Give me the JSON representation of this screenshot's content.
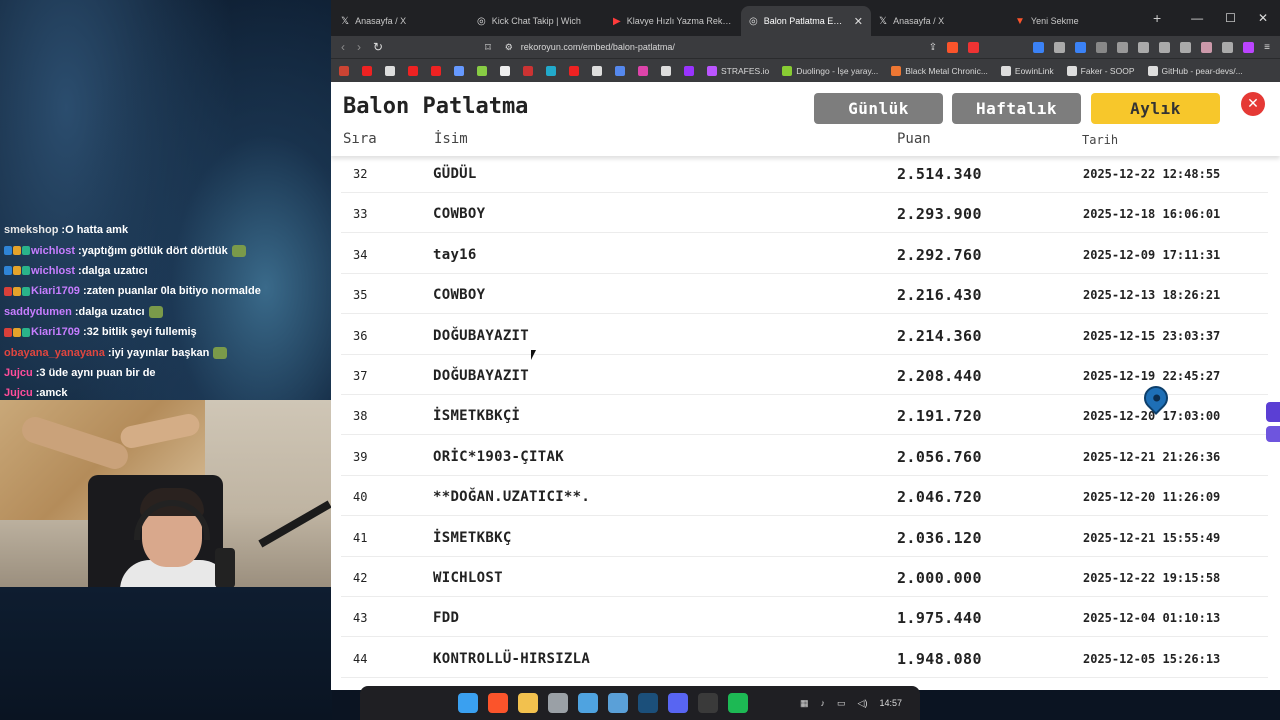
{
  "chat": [
    {
      "user": "smekshop",
      "msg": "O hatta amk",
      "user_color": "#e8e8e8",
      "badges": 0
    },
    {
      "user": "wichlost",
      "msg": "yaptığım götlük dört dörtlük",
      "user_color": "#c77dff",
      "badges": 3,
      "emote": true
    },
    {
      "user": "wichlost",
      "msg": "dalga uzatıcı",
      "user_color": "#c77dff",
      "badges": 3
    },
    {
      "user": "Kiari1709",
      "msg": "zaten puanlar 0la bitiyo normalde",
      "user_color": "#c77dff",
      "badges": 3
    },
    {
      "user": "saddydumen",
      "msg": "dalga uzatıcı",
      "user_color": "#c77dff",
      "badges": 0,
      "emote": true
    },
    {
      "user": "Kiari1709",
      "msg": "32 bitlik şeyi fullemiş",
      "user_color": "#c77dff",
      "badges": 3
    },
    {
      "user": "obayana_yanayana",
      "msg": "iyi yayınlar başkan",
      "user_color": "#e0463f",
      "badges": 0,
      "emote": true
    },
    {
      "user": "Jujcu",
      "msg": "3 üde aynı puan bir de",
      "user_color": "#ff4d9a",
      "badges": 0
    },
    {
      "user": "Jujcu",
      "msg": "amck",
      "user_color": "#ff4d9a",
      "badges": 0
    }
  ],
  "browser": {
    "tabs": [
      {
        "title": "Anasayfa / X",
        "icon": "x-icon",
        "glyph": "𝕏",
        "active": false
      },
      {
        "title": "Kick Chat Takip | Wich",
        "icon": "globe-icon",
        "glyph": "◎",
        "active": false
      },
      {
        "title": "Klavye Hızlı Yazma Rekoru Kı",
        "icon": "youtube-icon",
        "glyph": "▶",
        "active": false
      },
      {
        "title": "Balon Patlatma Embed E",
        "icon": "globe-icon",
        "glyph": "◎",
        "active": true
      },
      {
        "title": "Anasayfa / X",
        "icon": "x-icon",
        "glyph": "𝕏",
        "active": false
      },
      {
        "title": "Yeni Sekme",
        "icon": "brave-icon",
        "glyph": "▼",
        "active": false
      }
    ],
    "url": "rekoroyun.com/embed/balon-patlatma/",
    "bookmarks": [
      {
        "label": "",
        "color": "#c43"
      },
      {
        "label": "",
        "color": "#e22"
      },
      {
        "label": "",
        "color": "#ddd"
      },
      {
        "label": "",
        "color": "#e22"
      },
      {
        "label": "",
        "color": "#e22"
      },
      {
        "label": "",
        "color": "#69f"
      },
      {
        "label": "",
        "color": "#8c4"
      },
      {
        "label": "",
        "color": "#eee"
      },
      {
        "label": "",
        "color": "#c33"
      },
      {
        "label": "",
        "color": "#2ac"
      },
      {
        "label": "",
        "color": "#e22"
      },
      {
        "label": "",
        "color": "#ddd"
      },
      {
        "label": "",
        "color": "#58e"
      },
      {
        "label": "",
        "color": "#d4a"
      },
      {
        "label": "",
        "color": "#ddd"
      },
      {
        "label": "",
        "color": "#93f"
      },
      {
        "label": "STRAFES.io",
        "color": "#b5f"
      },
      {
        "label": "Duolingo - İşe yaray...",
        "color": "#8c3"
      },
      {
        "label": "Black Metal Chronic...",
        "color": "#e73"
      },
      {
        "label": "EowinLink",
        "color": "#ddd"
      },
      {
        "label": "Faker - SOOP",
        "color": "#ddd"
      },
      {
        "label": "GitHub - pear-devs/...",
        "color": "#ddd"
      }
    ]
  },
  "page": {
    "title": "Balon Patlatma",
    "buttons": {
      "daily": "Günlük",
      "weekly": "Haftalık",
      "monthly": "Aylık"
    },
    "columns": {
      "rank": "Sıra",
      "name": "İsim",
      "score": "Puan",
      "date": "Tarih"
    },
    "colors": {
      "inactive_btn": "#7d7d7d",
      "active_btn": "#f7c72b",
      "close": "#e53935"
    }
  },
  "leaderboard": [
    {
      "rank": "32",
      "name": "GÜDÜL",
      "score": "2.514.340",
      "date": "2025-12-22 12:48:55"
    },
    {
      "rank": "33",
      "name": "COWBOY",
      "score": "2.293.900",
      "date": "2025-12-18 16:06:01"
    },
    {
      "rank": "34",
      "name": "tay16",
      "score": "2.292.760",
      "date": "2025-12-09 17:11:31"
    },
    {
      "rank": "35",
      "name": "COWBOY",
      "score": "2.216.430",
      "date": "2025-12-13 18:26:21"
    },
    {
      "rank": "36",
      "name": "DOĞUBAYAZIT",
      "score": "2.214.360",
      "date": "2025-12-15 23:03:37"
    },
    {
      "rank": "37",
      "name": "DOĞUBAYAZIT",
      "score": "2.208.440",
      "date": "2025-12-19 22:45:27"
    },
    {
      "rank": "38",
      "name": "İSMETKBKÇİ",
      "score": "2.191.720",
      "date": "2025-12-20 17:03:00"
    },
    {
      "rank": "39",
      "name": "ORİC*1903-ÇITAK",
      "score": "2.056.760",
      "date": "2025-12-21 21:26:36"
    },
    {
      "rank": "40",
      "name": "**DOĞAN.UZATICI**.",
      "score": "2.046.720",
      "date": "2025-12-20 11:26:09"
    },
    {
      "rank": "41",
      "name": "İSMETKBKÇ",
      "score": "2.036.120",
      "date": "2025-12-21 15:55:49"
    },
    {
      "rank": "42",
      "name": "WICHLOST",
      "score": "2.000.000",
      "date": "2025-12-22 19:15:58"
    },
    {
      "rank": "43",
      "name": "FDD",
      "score": "1.975.440",
      "date": "2025-12-04 01:10:13"
    },
    {
      "rank": "44",
      "name": "KONTROLLÜ-HIRSIZLA",
      "score": "1.948.080",
      "date": "2025-12-05 15:26:13"
    }
  ],
  "taskbar": {
    "clock": "14:57",
    "apps": [
      {
        "name": "windows-start-icon",
        "color": "#3aa0f0"
      },
      {
        "name": "brave-icon",
        "color": "#fb542b"
      },
      {
        "name": "folder-icon",
        "color": "#f2c14e"
      },
      {
        "name": "tool-icon",
        "color": "#9aa0a6"
      },
      {
        "name": "photos-icon",
        "color": "#4fa3e0"
      },
      {
        "name": "app-icon",
        "color": "#5aa0d8"
      },
      {
        "name": "steam-icon",
        "color": "#1b4f7a"
      },
      {
        "name": "discord-icon",
        "color": "#5865f2"
      },
      {
        "name": "obs-icon",
        "color": "#3a3a3a"
      },
      {
        "name": "spotify-icon",
        "color": "#1db954"
      }
    ]
  }
}
